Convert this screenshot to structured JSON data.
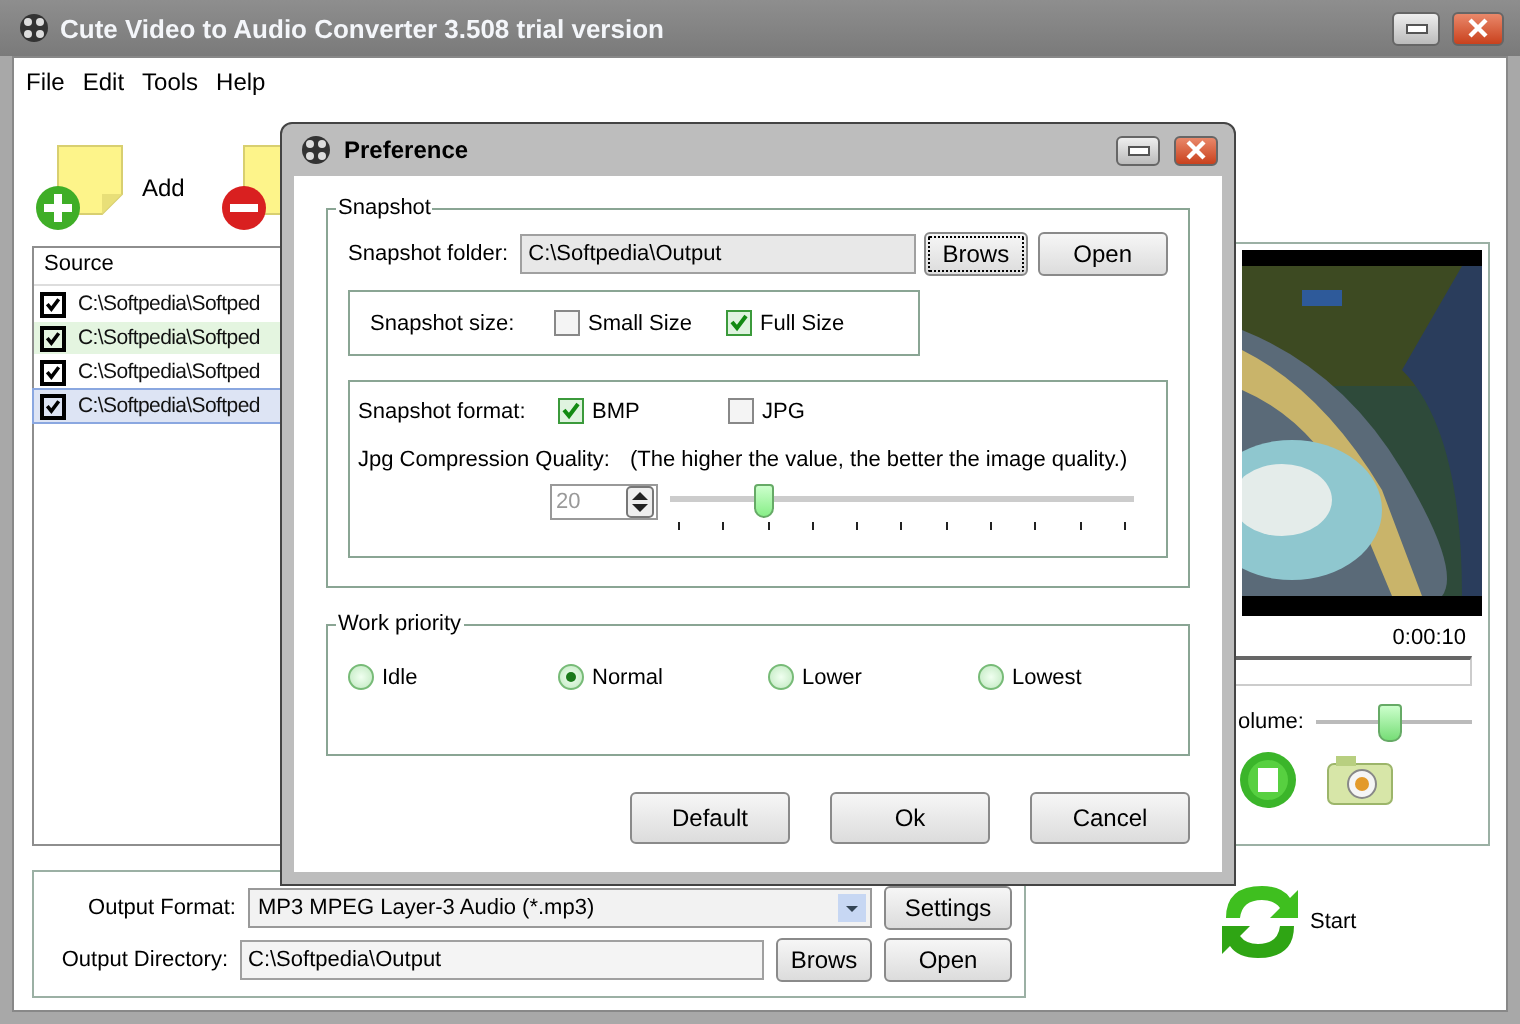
{
  "window": {
    "title": "Cute Video to Audio Converter 3.508  trial version"
  },
  "menu": [
    {
      "label": "File"
    },
    {
      "label": "Edit"
    },
    {
      "label": "Tools"
    },
    {
      "label": "Help"
    }
  ],
  "toolbar": [
    {
      "kind": "add",
      "label": "Add"
    },
    {
      "kind": "remove"
    }
  ],
  "file_list": {
    "column": "Source",
    "rows": [
      {
        "path": "C:\\Softpedia\\Softped",
        "checked": true,
        "selected": false,
        "highlighted": false
      },
      {
        "path": "C:\\Softpedia\\Softped",
        "checked": true,
        "selected": false,
        "highlighted": true
      },
      {
        "path": "C:\\Softpedia\\Softped",
        "checked": true,
        "selected": false,
        "highlighted": false
      },
      {
        "path": "C:\\Softpedia\\Softped",
        "checked": true,
        "selected": true,
        "highlighted": false
      }
    ]
  },
  "output": {
    "format_label": "Output Format:",
    "format_value": "MP3 MPEG Layer-3 Audio (*.mp3)",
    "settings_button": "Settings",
    "directory_label": "Output Directory:",
    "directory_value": "C:\\Softpedia\\Output",
    "browse_button": "Brows",
    "open_button": "Open"
  },
  "player": {
    "time": "0:00:10",
    "progress": {
      "level": 0
    },
    "volume_label": "olume:",
    "volume": {
      "level": 0.46
    },
    "start_label": "Start"
  },
  "dialog": {
    "title": "Preference",
    "snapshot": {
      "legend": "Snapshot",
      "folder_label": "Snapshot folder:",
      "folder_value": "C:\\Softpedia\\Output",
      "browse_button": "Brows",
      "open_button": "Open",
      "size_label": "Snapshot size:",
      "sizes": [
        {
          "label": "Small Size",
          "checked": false
        },
        {
          "label": "Full Size",
          "checked": true
        }
      ],
      "format_label": "Snapshot format:",
      "formats": [
        {
          "label": "BMP",
          "checked": true
        },
        {
          "label": "JPG",
          "checked": false
        }
      ],
      "quality_label": "Jpg Compression Quality:",
      "quality_hint": "(The higher the value, the better the image quality.)",
      "quality_value": "20",
      "quality_disabled": true,
      "quality": {
        "level": 0.2
      }
    },
    "priority": {
      "legend": "Work priority",
      "options": [
        {
          "label": "Idle",
          "selected": false
        },
        {
          "label": "Normal",
          "selected": true
        },
        {
          "label": "Lower",
          "selected": false
        },
        {
          "label": "Lowest",
          "selected": false
        }
      ]
    },
    "buttons": [
      "Default",
      "Ok",
      "Cancel"
    ]
  }
}
